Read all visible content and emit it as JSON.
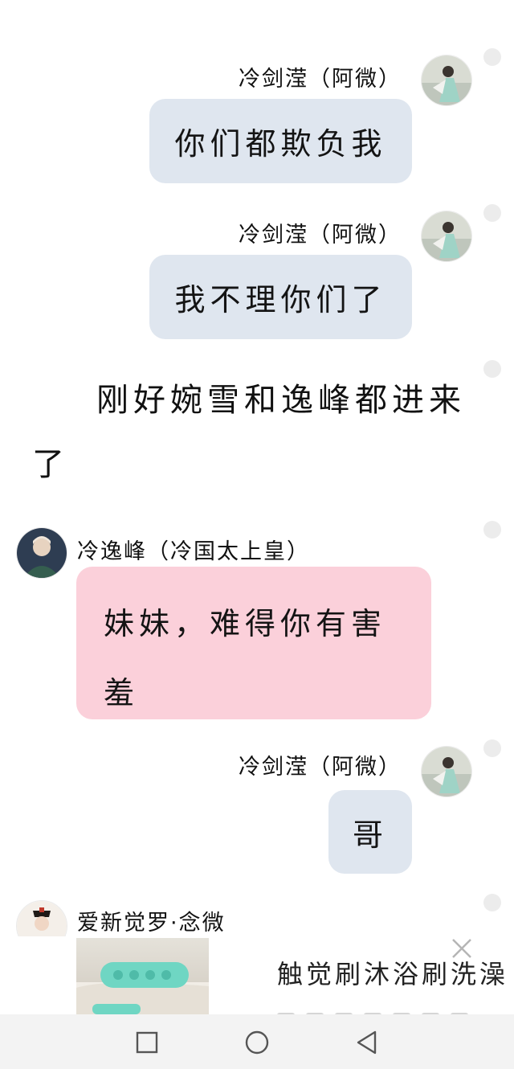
{
  "messages": [
    {
      "sender": "冷剑滢（阿微）",
      "text": "你们都欺负我"
    },
    {
      "sender": "冷剑滢（阿微）",
      "text": "我不理你们了"
    },
    {
      "narration": "刚好婉雪和逸峰都进来了"
    },
    {
      "sender": "冷逸峰（冷国太上皇）",
      "text": "妹妹，难得你有害羞"
    },
    {
      "sender": "冷剑滢（阿微）",
      "text": "哥"
    },
    {
      "sender": "爱新觉罗·念微"
    }
  ],
  "ad": {
    "title": "触觉刷沐浴刷洗澡"
  },
  "navbar": {
    "icons": [
      "recent-apps-square-icon",
      "home-circle-icon",
      "back-triangle-icon"
    ]
  },
  "colors": {
    "my_bubble": "#dfe6ef",
    "their_bubble": "#fbd0da",
    "navbar": "#f3f3f3"
  }
}
